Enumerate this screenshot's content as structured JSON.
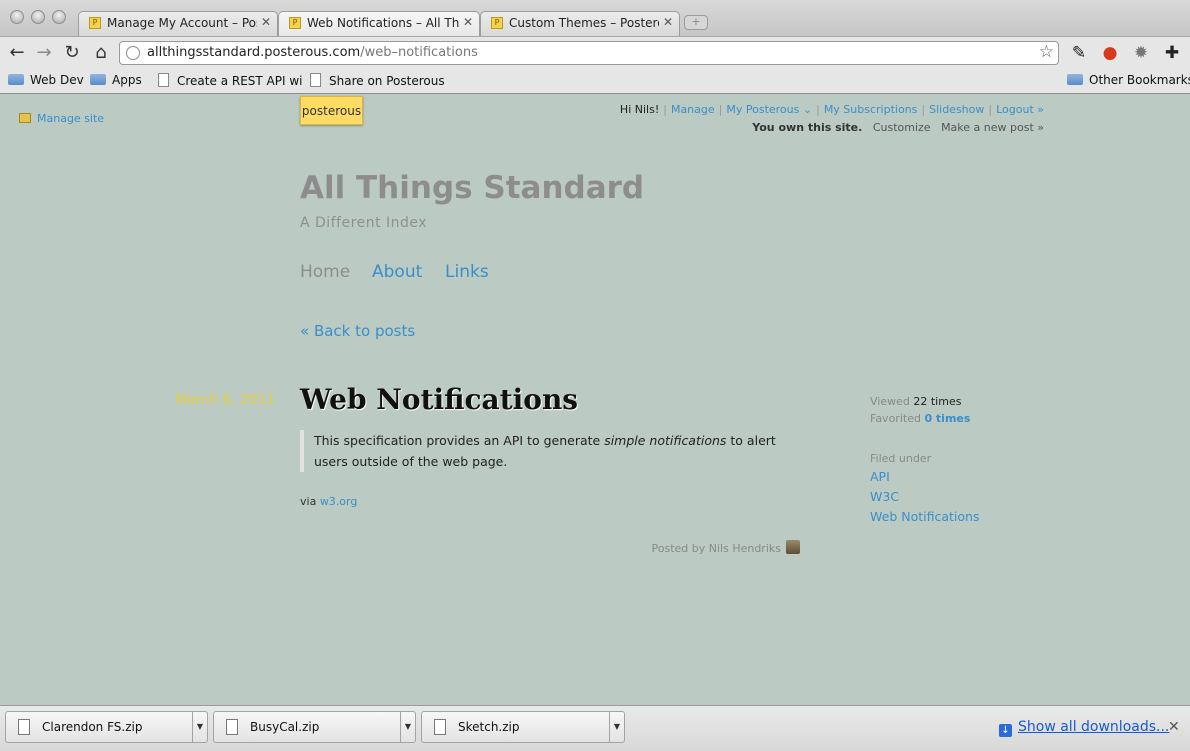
{
  "browser": {
    "tabs": [
      {
        "title": "Manage My Account – Poster",
        "favicon": "P"
      },
      {
        "title": "Web Notifications – All Thing",
        "favicon": "P"
      },
      {
        "title": "Custom Themes – Posterous",
        "favicon": "P"
      }
    ],
    "tab_close": "✕",
    "new_tab": "+",
    "url_host": "allthingsstandard.posterous.com",
    "url_path": "/web–notifications",
    "bookmarks": [
      "Web Dev",
      "Apps",
      "Create a REST API wi",
      "Share on Posterous"
    ],
    "other_bookmarks": "Other Bookmarks"
  },
  "page": {
    "manage_site": "Manage site",
    "logo": "posterous",
    "topnav": {
      "greeting": "Hi Nils!",
      "manage": "Manage",
      "my_posterous": "My Posterous ⌄",
      "my_subscriptions": "My Subscriptions",
      "slideshow": "Slideshow",
      "logout": "Logout »"
    },
    "own_line": {
      "own": "You own this site.",
      "customize": "Customize",
      "new_post": "Make a new post »"
    },
    "site_title": "All Things Standard",
    "site_subtitle": "A Different Index",
    "nav": [
      "Home",
      "About",
      "Links"
    ],
    "back": "« Back to posts",
    "post": {
      "date": "March 6, 2011",
      "title": "Web Notifications",
      "quote_pre": "This specification provides an API to generate ",
      "quote_em": "simple notifications",
      "quote_post": " to alert users outside of the web page.",
      "via_label": "via ",
      "via_link": "w3.org",
      "posted_by": "Posted by Nils Hendriks"
    },
    "stats": {
      "viewed_label": "Viewed ",
      "viewed_count": "22 times",
      "favorited_label": "Favorited ",
      "favorited_count": "0 times"
    },
    "filed_under": "Filed under",
    "tags": [
      "API",
      "W3C",
      "Web Notifications"
    ]
  },
  "downloads": {
    "items": [
      "Clarendon FS.zip",
      "BusyCal.zip",
      "Sketch.zip"
    ],
    "show_all": "Show all downloads..."
  },
  "colors": {
    "page_bg": "#bbcbc3",
    "link": "#3a8fc9",
    "date": "#e8cf3f",
    "logo_bg": "#fedc63"
  }
}
